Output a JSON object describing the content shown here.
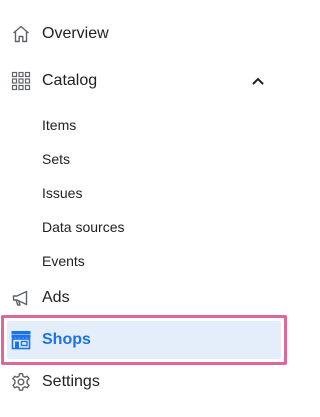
{
  "colors": {
    "text": "#202124",
    "active_text": "#1a73e8",
    "active_bg": "#e4eefb",
    "highlight_border": "#e0679a",
    "icon": "#5f6368"
  },
  "nav": {
    "items": [
      {
        "label": "Overview",
        "icon": "home-icon"
      },
      {
        "label": "Catalog",
        "icon": "grid-icon",
        "expanded": true
      },
      {
        "label": "Ads",
        "icon": "megaphone-icon"
      },
      {
        "label": "Shops",
        "icon": "storefront-icon",
        "active": true
      },
      {
        "label": "Settings",
        "icon": "gear-icon"
      }
    ],
    "catalog_children": [
      "Items",
      "Sets",
      "Issues",
      "Data sources",
      "Events"
    ]
  }
}
